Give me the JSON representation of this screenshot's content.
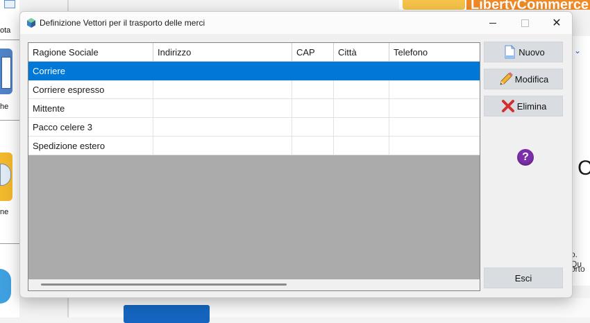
{
  "window": {
    "title": "Definizione Vettori per il trasporto delle merci"
  },
  "table": {
    "columns": [
      "Ragione Sociale",
      "Indirizzo",
      "CAP",
      "Città",
      "Telefono"
    ],
    "rows": [
      [
        "Corriere",
        "",
        "",
        "",
        ""
      ],
      [
        "Corriere espresso",
        "",
        "",
        "",
        ""
      ],
      [
        "Mittente",
        "",
        "",
        "",
        ""
      ],
      [
        "Pacco celere 3",
        "",
        "",
        "",
        ""
      ],
      [
        "Spedizione estero",
        "",
        "",
        "",
        ""
      ]
    ],
    "selected_row": 0
  },
  "buttons": {
    "new": "Nuovo",
    "edit": "Modifica",
    "delete": "Elimina",
    "help": "?",
    "exit": "Esci"
  },
  "background": {
    "left_labels": [
      "ota",
      "he",
      "ne"
    ],
    "brand": "LibertyCommerce",
    "side_text_1": "o. Qu",
    "side_text_2": "orto",
    "big_letter": "C"
  },
  "colors": {
    "selection": "#0078d7",
    "grid_empty": "#ababab",
    "button_face": "#d9dde2",
    "help_icon": "#7b2fa8",
    "brand": "#f08a24"
  },
  "icons": {
    "new": "document-icon",
    "edit": "pencil-icon",
    "delete": "red-x-icon",
    "help": "question-icon"
  }
}
